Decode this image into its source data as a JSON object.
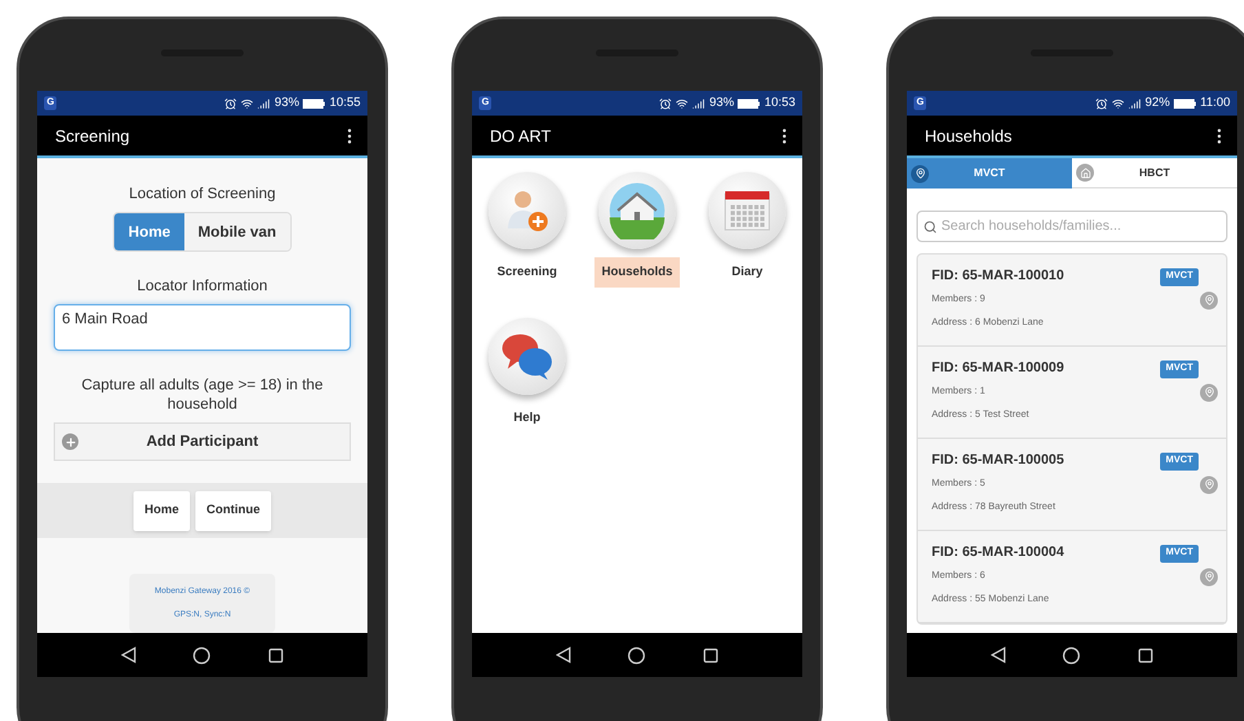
{
  "phones": [
    {
      "kind": "screening",
      "status_bar": {
        "carrier": "G",
        "battery": "93%",
        "time": "10:55"
      },
      "title": "Screening",
      "location_label": "Location of Screening",
      "location_options": [
        {
          "label": "Home",
          "selected": true
        },
        {
          "label": "Mobile van",
          "selected": false
        }
      ],
      "locator_label": "Locator Information",
      "locator_value": "6 Main Road",
      "instruction": "Capture all adults (age >= 18) in the household",
      "add_button": "Add Participant",
      "footer_buttons": [
        "Home",
        "Continue"
      ],
      "footer_lines": [
        "Mobenzi Gateway 2016 ©",
        "GPS:N, Sync:N"
      ]
    },
    {
      "kind": "menu",
      "status_bar": {
        "carrier": "G",
        "battery": "93%",
        "time": "10:53"
      },
      "title": "DO ART",
      "tiles": [
        {
          "kind": "screening",
          "label": "Screening",
          "selected": false
        },
        {
          "kind": "households",
          "label": "Households",
          "selected": true
        },
        {
          "kind": "diary",
          "label": "Diary",
          "selected": false
        },
        {
          "kind": "help",
          "label": "Help",
          "selected": false
        }
      ]
    },
    {
      "kind": "households",
      "status_bar": {
        "carrier": "G",
        "battery": "92%",
        "time": "11:00"
      },
      "title": "Households",
      "tabs": [
        {
          "kind": "pin",
          "label": "MVCT",
          "selected": true
        },
        {
          "kind": "home",
          "label": "HBCT",
          "selected": false
        }
      ],
      "search": {
        "placeholder": "Search households/families..."
      },
      "households": [
        {
          "fid": "FID: 65-MAR-100010",
          "members": "Members : 9",
          "address": "Address : 6 Mobenzi Lane",
          "tag": "MVCT"
        },
        {
          "fid": "FID: 65-MAR-100009",
          "members": "Members : 1",
          "address": "Address : 5 Test Street",
          "tag": "MVCT"
        },
        {
          "fid": "FID: 65-MAR-100005",
          "members": "Members : 5",
          "address": "Address : 78 Bayreuth Street",
          "tag": "MVCT"
        },
        {
          "fid": "FID: 65-MAR-100004",
          "members": "Members : 6",
          "address": "Address : 55 Mobenzi Lane",
          "tag": "MVCT"
        }
      ]
    }
  ]
}
